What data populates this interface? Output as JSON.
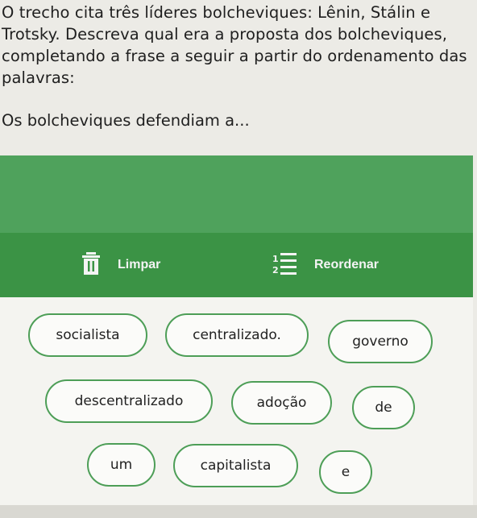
{
  "question": {
    "text": "O trecho cita três líderes bolcheviques: Lênin, Stálin e Trotsky. Descreva qual era a proposta dos bolcheviques, completando a frase a seguir a partir do ordenamento das palavras:",
    "prompt": "Os bolcheviques defendiam a..."
  },
  "toolbar": {
    "clear_label": "Limpar",
    "clear_icon": "trash-icon",
    "reorder_label": "Reordenar",
    "reorder_icon": "numbered-list-icon",
    "reorder_digit_1": "1",
    "reorder_digit_2": "2"
  },
  "colors": {
    "answer_area": "#4fa25c",
    "toolbar": "#3b9345",
    "chip_border": "#4d9e57"
  },
  "word_bank": [
    "socialista",
    "centralizado.",
    "governo",
    "descentralizado",
    "adoção",
    "de",
    "um",
    "capitalista",
    "e"
  ]
}
